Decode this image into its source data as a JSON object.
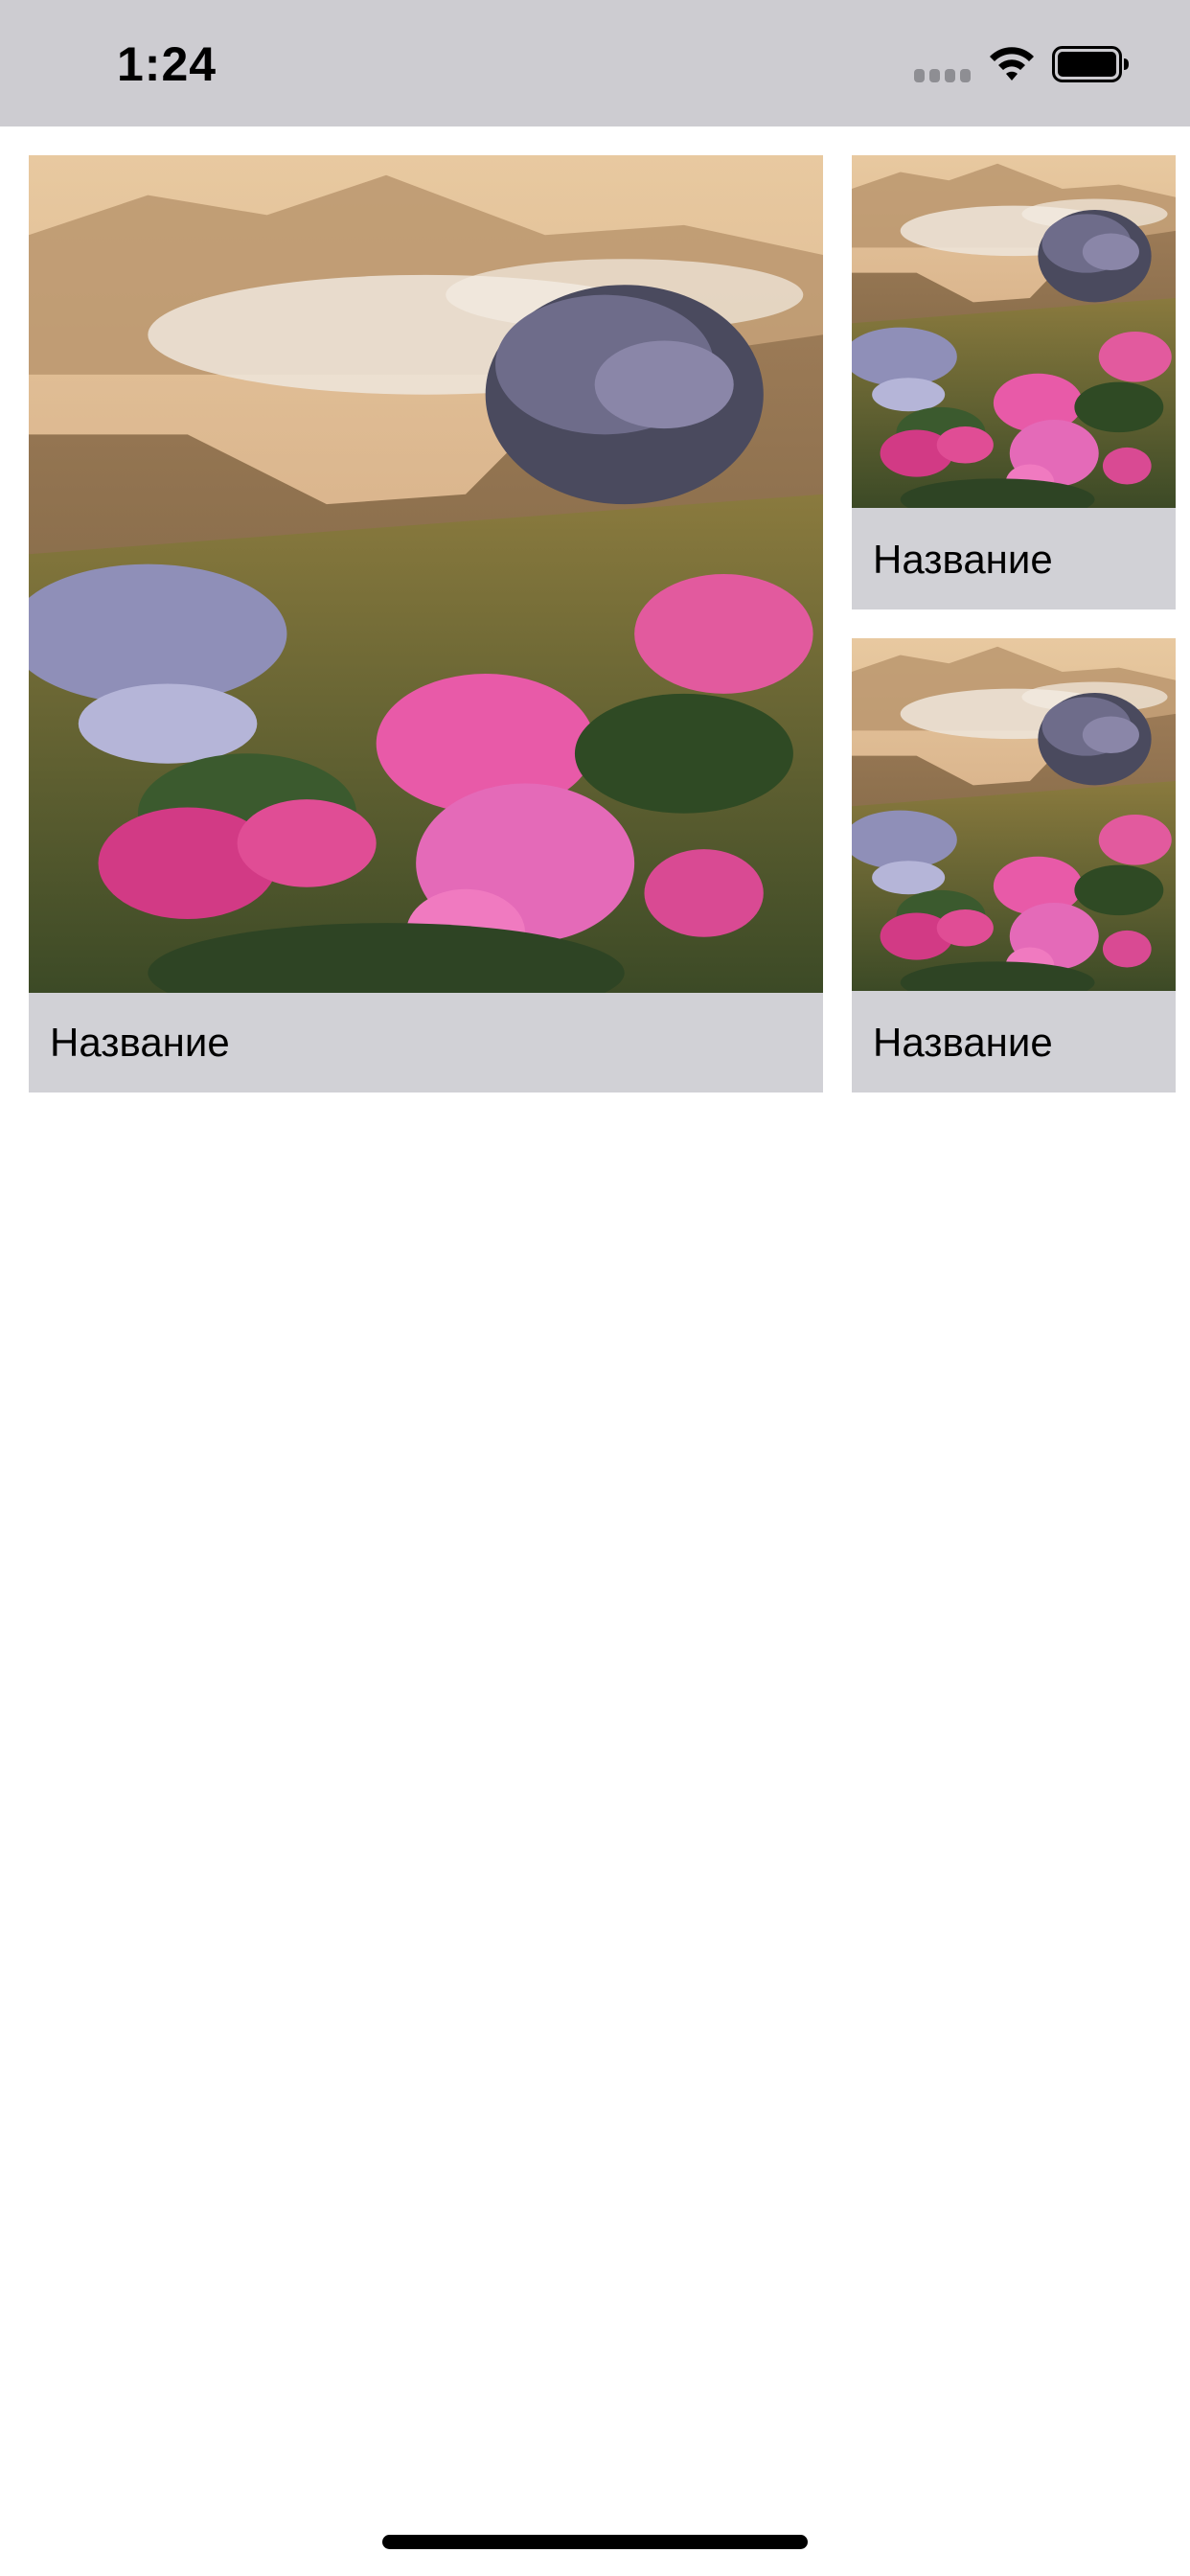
{
  "status_bar": {
    "time": "1:24",
    "icons": [
      "cellular-signal-icon",
      "wifi-icon",
      "battery-icon"
    ]
  },
  "cards": [
    {
      "title": "Название",
      "image": "mountain-rhododendron-photo"
    },
    {
      "title": "Название",
      "image": "mountain-rhododendron-photo"
    },
    {
      "title": "Название",
      "image": "mountain-rhododendron-photo"
    }
  ],
  "colors": {
    "status_bar_bg": "#cdccd1",
    "caption_bg": "#d1d1d6",
    "page_bg": "#ffffff",
    "text": "#000000"
  }
}
